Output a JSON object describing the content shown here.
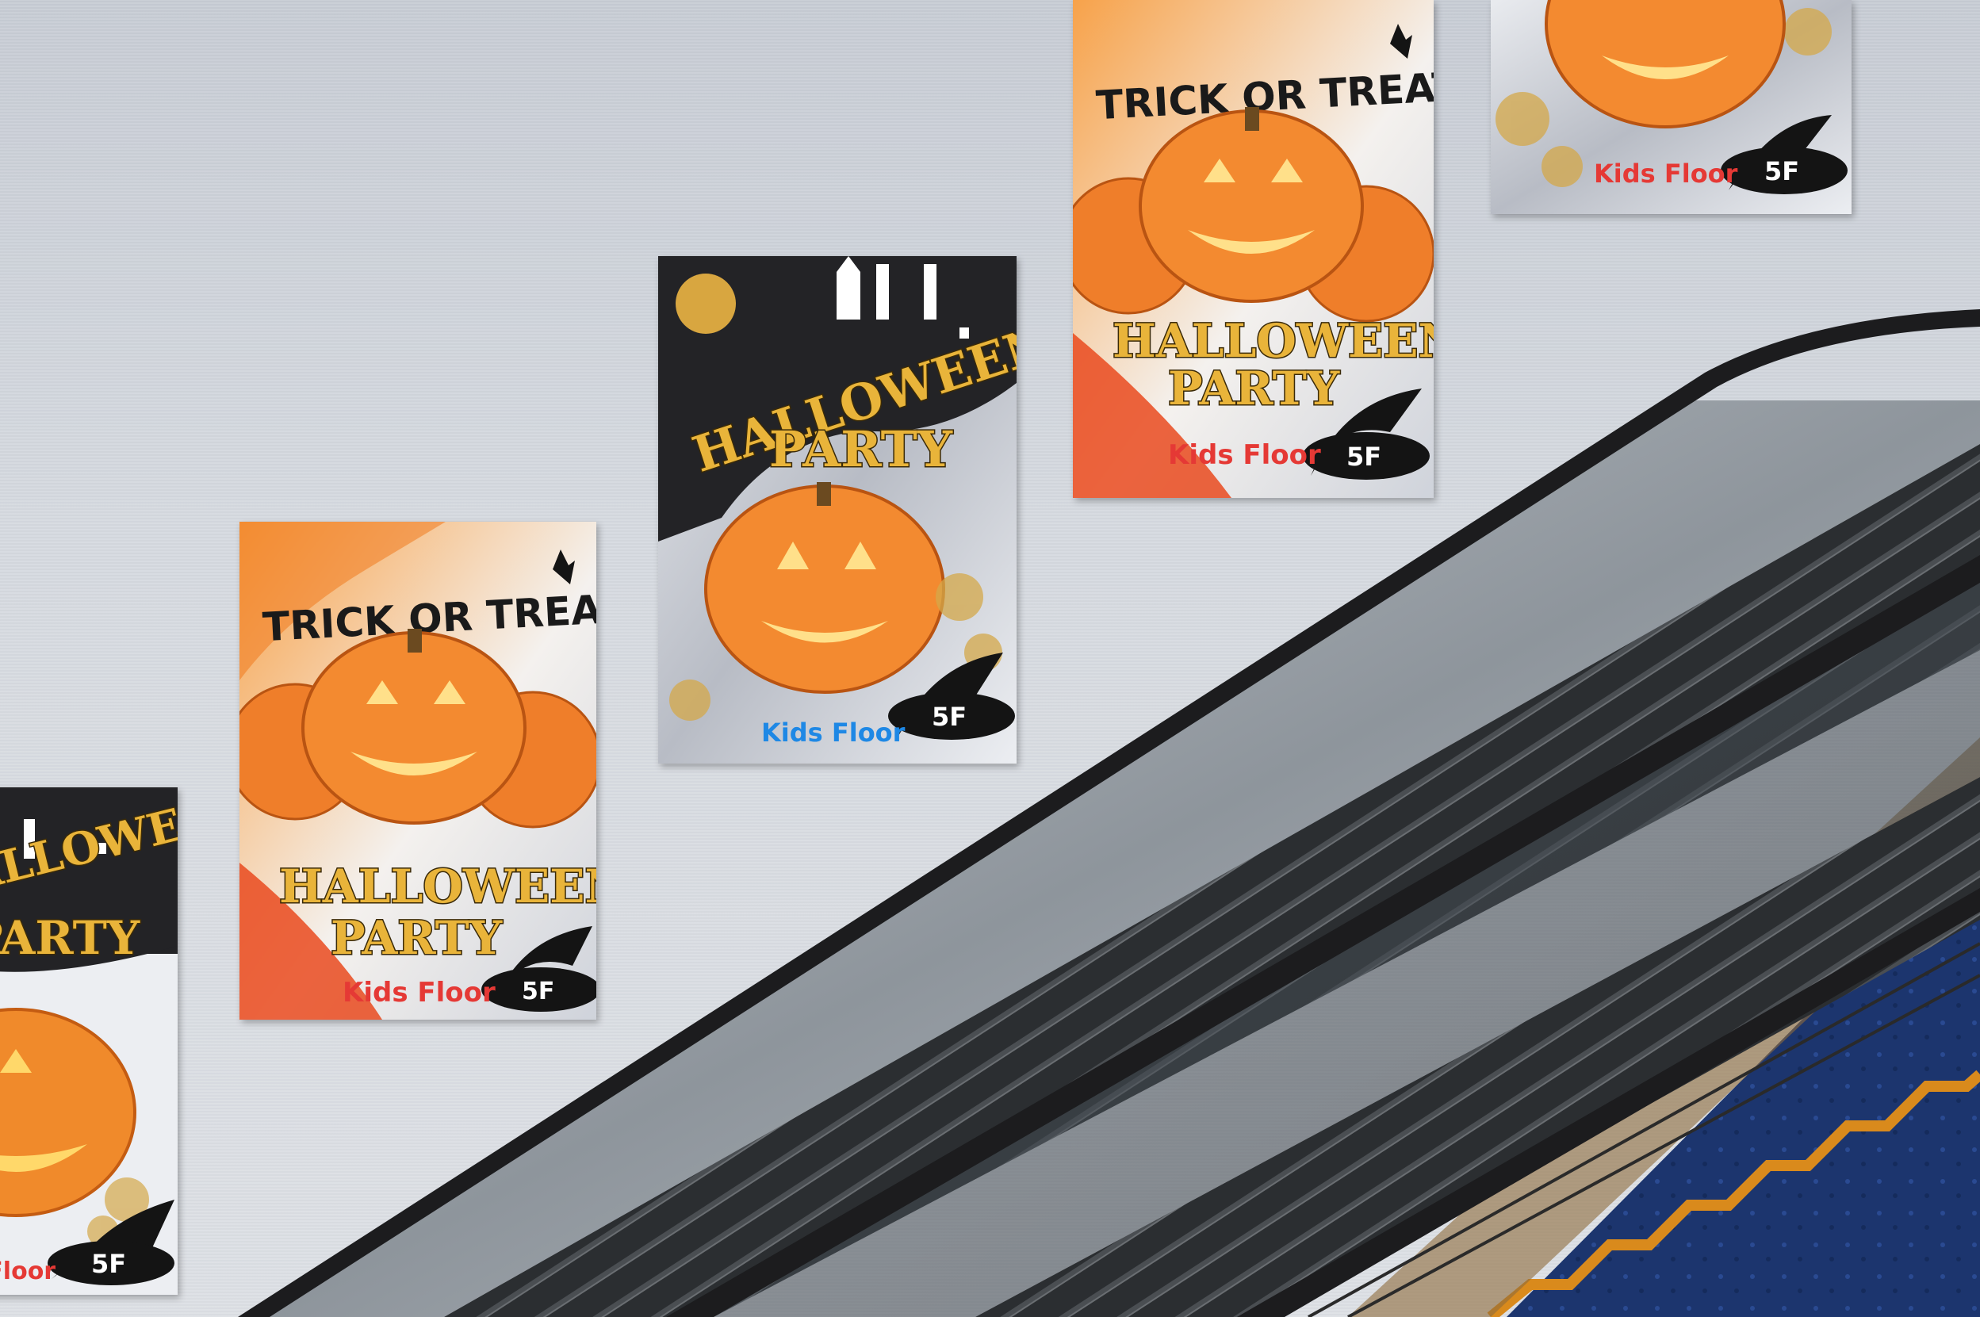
{
  "scene": {
    "description_colors": {
      "wall": "#d6dae0",
      "handrail": "#1c1c1e",
      "balustrade_metal": "#9aa0a6",
      "stair_carpet": "#1e3b7a",
      "stair_trim": "#d98a1c"
    }
  },
  "posters": [
    {
      "variant": "dark",
      "title_line1": "HALLOWEEN",
      "title_line2": "PARTY",
      "brand": "Kids Floor",
      "floor": "5F"
    },
    {
      "variant": "orange",
      "tagline": "TRICK OR TREAT",
      "title_line1": "HALLOWEEN",
      "title_line2": "PARTY",
      "brand": "Kids Floor",
      "floor": "5F"
    },
    {
      "variant": "dark",
      "title_line1": "HALLOWEEN",
      "title_line2": "PARTY",
      "brand": "Kids Floor",
      "floor": "5F"
    },
    {
      "variant": "orange",
      "tagline": "TRICK OR TREAT",
      "title_line1": "HALLOWEEN",
      "title_line2": "PARTY",
      "brand": "Kids Floor",
      "floor": "5F"
    },
    {
      "variant": "dark",
      "brand": "Kids Floor",
      "floor": "5F"
    }
  ],
  "brand_colors": [
    "#e53935",
    "#1e88e5",
    "#43a047",
    "#fb8c00",
    "#8e24aa",
    "#e91e63",
    "#00acc1",
    "#fdd835",
    "#e53935"
  ]
}
